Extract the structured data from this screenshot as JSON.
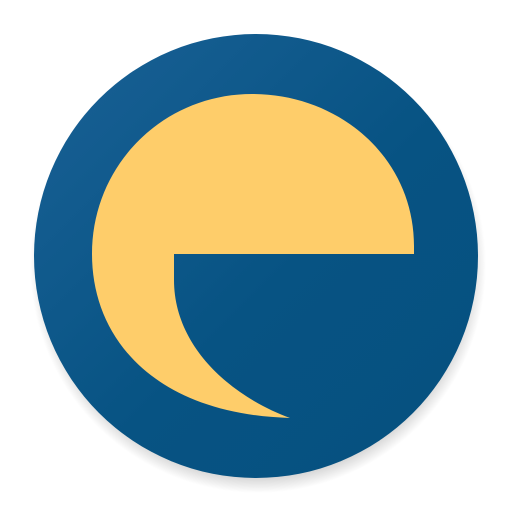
{
  "app_icon": {
    "icon": "letter-e-logo-icon",
    "colors": {
      "circle": "#075383",
      "circle_highlight": "#1a6196",
      "letter": "#fecd6a",
      "background": "#ffffff"
    }
  }
}
